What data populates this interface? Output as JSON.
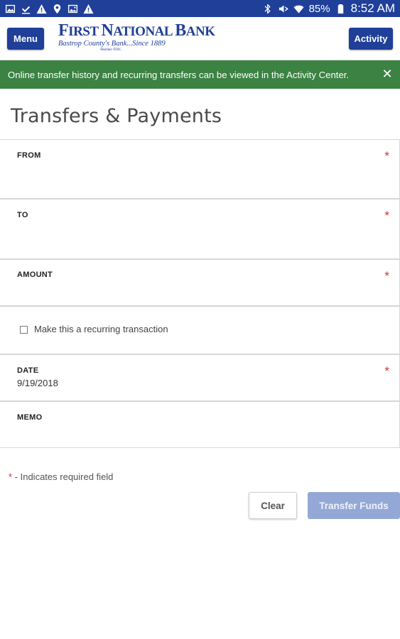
{
  "status_bar": {
    "left_icons": [
      "image-icon",
      "download-done-icon",
      "warning-icon",
      "location-icon",
      "gallery-icon",
      "warning-icon"
    ],
    "right_icons": [
      "bluetooth-icon",
      "mute-icon",
      "wifi-icon",
      "battery-icon"
    ],
    "battery": "85%",
    "time": "8:52 AM"
  },
  "header": {
    "menu_label": "Menu",
    "activity_label": "Activity",
    "logo": {
      "name": "First National Bank",
      "tagline": "Bastrop County's Bank...Since 1889",
      "member": "Member FDIC"
    }
  },
  "notice": {
    "text": "Online transfer history and recurring transfers can be viewed in the Activity Center.",
    "close_icon": "close-icon"
  },
  "page": {
    "title": "Transfers & Payments"
  },
  "form": {
    "from_label": "FROM",
    "to_label": "TO",
    "amount_label": "AMOUNT",
    "recurring_label": "Make this a recurring transaction",
    "recurring_checked": false,
    "date_label": "DATE",
    "date_value": "9/19/2018",
    "memo_label": "MEMO",
    "required_mark": "*"
  },
  "footer": {
    "required_star": "*",
    "required_note": " - Indicates required field",
    "clear_label": "Clear",
    "transfer_label": "Transfer Funds"
  },
  "colors": {
    "primary": "#1f3f99",
    "notice_green": "#3b8243",
    "required_red": "#d23030",
    "disabled_button": "#93a8d6"
  }
}
